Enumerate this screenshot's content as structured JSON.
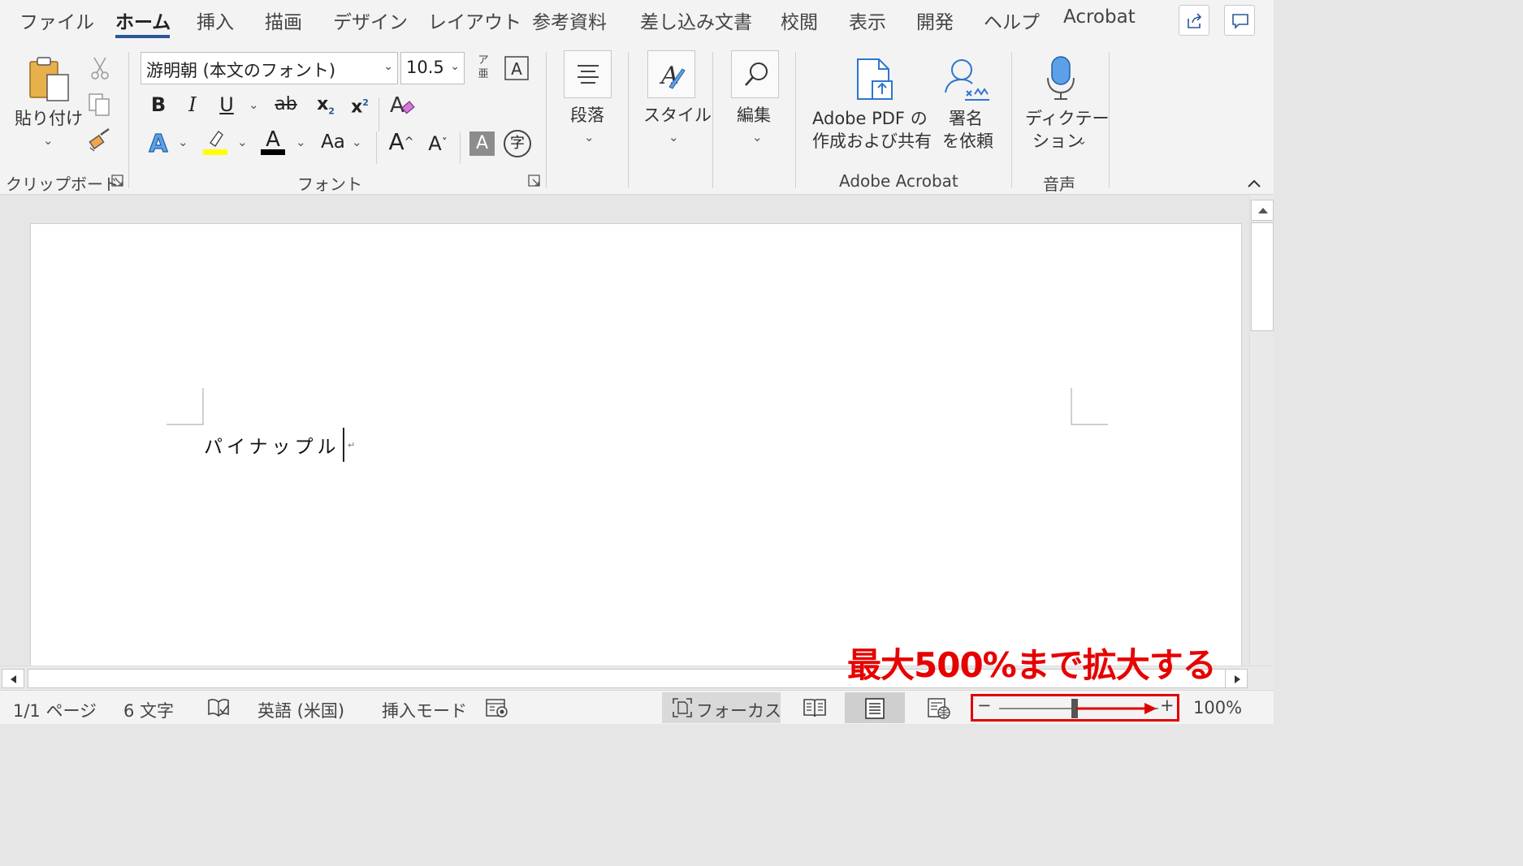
{
  "tabs": [
    {
      "label": "ファイル",
      "active": false
    },
    {
      "label": "ホーム",
      "active": true
    },
    {
      "label": "挿入",
      "active": false
    },
    {
      "label": "描画",
      "active": false
    },
    {
      "label": "デザイン",
      "active": false
    },
    {
      "label": "レイアウト",
      "active": false
    },
    {
      "label": "参考資料",
      "active": false
    },
    {
      "label": "差し込み文書",
      "active": false
    },
    {
      "label": "校閲",
      "active": false
    },
    {
      "label": "表示",
      "active": false
    },
    {
      "label": "開発",
      "active": false
    },
    {
      "label": "ヘルプ",
      "active": false
    },
    {
      "label": "Acrobat",
      "active": false
    }
  ],
  "ribbon": {
    "clipboard": {
      "paste_label": "貼り付け",
      "group_label": "クリップボード"
    },
    "font": {
      "font_name": "游明朝 (本文のフォント)",
      "font_size": "10.5",
      "furigana": "ア亜",
      "group_label": "フォント",
      "bold": "B",
      "italic": "I",
      "underline": "U",
      "strike": "ab",
      "subscript": "x",
      "superscript": "x",
      "change_case": "Aa",
      "grow": "A",
      "shrink": "A",
      "shading": "A",
      "enclose": "字"
    },
    "paragraph_label": "段落",
    "styles_label": "スタイル",
    "editing_label": "編集",
    "acrobat": {
      "create_share_line1": "Adobe PDF の",
      "create_share_line2": "作成および共有",
      "sign_line1": "署名",
      "sign_line2": "を依頼",
      "group_label": "Adobe Acrobat"
    },
    "voice": {
      "dictate_line1": "ディクテー",
      "dictate_line2": "ション",
      "group_label": "音声"
    }
  },
  "document": {
    "text": "パイナップル",
    "para_mark": "↵"
  },
  "status": {
    "page": "1/1 ページ",
    "words": "6 文字",
    "language": "英語 (米国)",
    "mode": "挿入モード",
    "focus": "フォーカス",
    "zoom_minus": "−",
    "zoom_plus": "+",
    "zoom_percent": "100%",
    "zoom_level": 100
  },
  "annotation": {
    "text": "最大500%まで拡大する",
    "color": "#e60000"
  },
  "colors": {
    "accent": "#2b579a",
    "highlight": "#ffff00",
    "font_color": "#000000",
    "text_effect": "#2e75d0"
  }
}
